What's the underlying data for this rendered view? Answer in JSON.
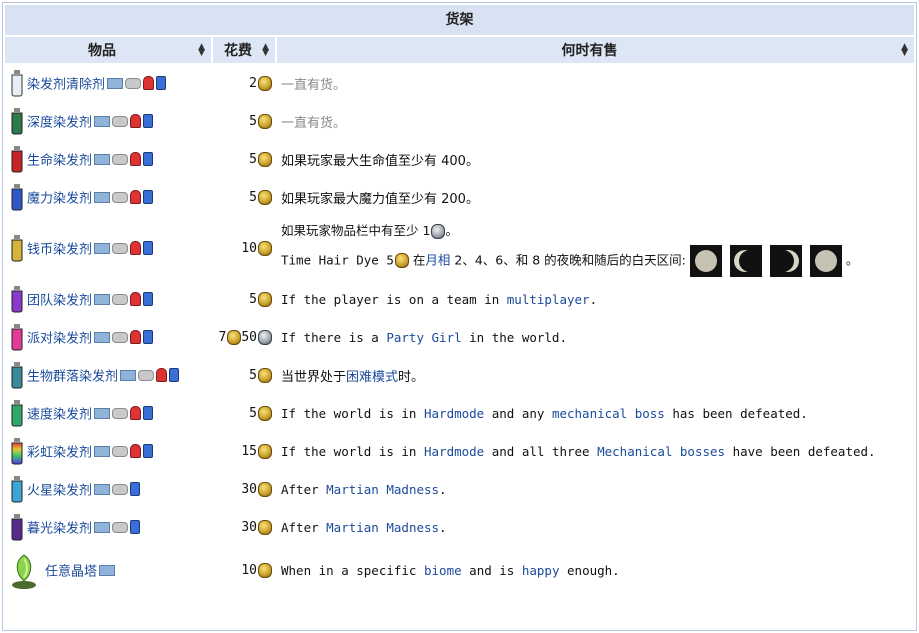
{
  "table": {
    "caption": "货架",
    "headers": {
      "item": "物品",
      "cost": "花费",
      "when": "何时有售"
    }
  },
  "rows": [
    {
      "name": "染发剂清除剂",
      "bottle_color": "#e8eef5",
      "cost": "2",
      "coin": "gold",
      "when": "一直有货。",
      "when_style": "gray"
    },
    {
      "name": "深度染发剂",
      "bottle_color": "#2e7a4a",
      "cost": "5",
      "coin": "gold",
      "when": "一直有货。",
      "when_style": "gray"
    },
    {
      "name": "生命染发剂",
      "bottle_color": "#c8232b",
      "cost": "5",
      "coin": "gold",
      "when": "如果玩家最大生命值至少有 400。"
    },
    {
      "name": "魔力染发剂",
      "bottle_color": "#2e57c8",
      "cost": "5",
      "coin": "gold",
      "when": "如果玩家最大魔力值至少有 200。"
    },
    {
      "name": "钱币染发剂",
      "bottle_color": "#d4b43a",
      "cost": "10",
      "coin": "gold",
      "when_line1": "如果玩家物品栏中有至少 1",
      "when_line1_end": "。",
      "when_line2_a": "Time Hair Dye 5",
      "when_line2_b": " 在",
      "when_line2_link": "月相",
      "when_line2_c": " 2、4、6、和 8 的夜晚和随后的白天区间:",
      "when_line2_end": "。"
    },
    {
      "name": "团队染发剂",
      "bottle_color": "#8a3ac8",
      "cost": "5",
      "coin": "gold",
      "when_parts": [
        "If the player is on a team in ",
        "multiplayer",
        "."
      ]
    },
    {
      "name": "派对染发剂",
      "bottle_color": "#e43a9a",
      "cost_a": "7",
      "cost_b": "50",
      "coin": "gold_silver",
      "when_parts": [
        "If there is a ",
        "Party Girl",
        " in the world."
      ]
    },
    {
      "name": "生物群落染发剂",
      "bottle_color": "#3a8a9a",
      "cost": "5",
      "coin": "gold",
      "when_parts_zh": [
        "当世界处于",
        "困难模式",
        "时。"
      ]
    },
    {
      "name": "速度染发剂",
      "bottle_color": "#2ea86a",
      "cost": "5",
      "coin": "gold",
      "when_parts4": [
        "If the world is in ",
        "Hardmode",
        " and any ",
        "mechanical boss",
        " has been defeated."
      ]
    },
    {
      "name": "彩虹染发剂",
      "bottle_color": "#e65a3a",
      "cost": "15",
      "coin": "gold",
      "when_parts4": [
        "If the world is in ",
        "Hardmode",
        " and all three ",
        "Mechanical bosses",
        " have been defeated."
      ]
    },
    {
      "name": "火星染发剂",
      "bottle_color": "#3aa6d4",
      "cost": "30",
      "coin": "gold",
      "when_parts": [
        "After ",
        "Martian Madness",
        "."
      ]
    },
    {
      "name": "暮光染发剂",
      "bottle_color": "#5a2a8a",
      "cost": "30",
      "coin": "gold",
      "when_parts": [
        "After ",
        "Martian Madness",
        "."
      ]
    },
    {
      "name": "任意晶塔",
      "bottle_color": "#6ab43a",
      "cost": "10",
      "coin": "gold",
      "when_parts4": [
        "When in a specific ",
        "biome",
        " and is ",
        "happy",
        " enough."
      ]
    }
  ]
}
